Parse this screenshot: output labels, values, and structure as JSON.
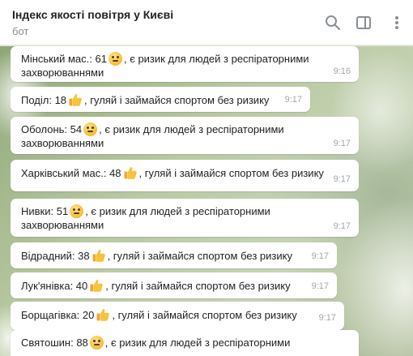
{
  "header": {
    "title": "Індекс якості повітря у Києві",
    "subtitle": "бот",
    "icons": [
      "search-icon",
      "sidebar-toggle-icon",
      "more-vertical-icon"
    ]
  },
  "colors": {
    "bubble": "#ffffff",
    "time": "#a0a6ab",
    "title": "#222222",
    "subtitle": "#8c8c8c"
  },
  "messages": [
    {
      "district_aqi": "Мінський мас.: 61",
      "emoji": "neutral-face-emoji",
      "line1": ", є ризик для людей з респіраторними",
      "line2": "захворюваннями",
      "time": "9:16"
    },
    {
      "district_aqi": "Поділ: 18",
      "emoji": "thumbs-up-emoji",
      "line1": ", гуляй і займайся спортом без ризику",
      "time": "9:17"
    },
    {
      "district_aqi": "Оболонь: 54",
      "emoji": "neutral-face-emoji",
      "line1": ", є ризик для людей з респіраторними",
      "line2": "захворюваннями",
      "time": "9:17"
    },
    {
      "district_aqi": "Харківський мас.: 48",
      "emoji": "thumbs-up-emoji",
      "line1": ", гуляй і займайся спортом без ризику",
      "time": "9:17"
    },
    {
      "district_aqi": "Нивки: 51",
      "emoji": "neutral-face-emoji",
      "line1": ", є ризик для людей з респіраторними",
      "line2": "захворюваннями",
      "time": "9:17"
    },
    {
      "district_aqi": "Відрадний: 38",
      "emoji": "thumbs-up-emoji",
      "line1": ", гуляй і займайся спортом без ризику",
      "time": "9:17"
    },
    {
      "district_aqi": "Лук'янівка: 40",
      "emoji": "thumbs-up-emoji",
      "line1": ", гуляй і займайся спортом без ризику",
      "time": "9:17"
    },
    {
      "district_aqi": "Борщагівка: 20",
      "emoji": "thumbs-up-emoji",
      "line1": ", гуляй і займайся спортом без ризику",
      "time": "9:17"
    },
    {
      "district_aqi": "Святошин: 88",
      "emoji": "neutral-face-emoji",
      "line1": ", є ризик для людей з респіраторними"
    }
  ]
}
